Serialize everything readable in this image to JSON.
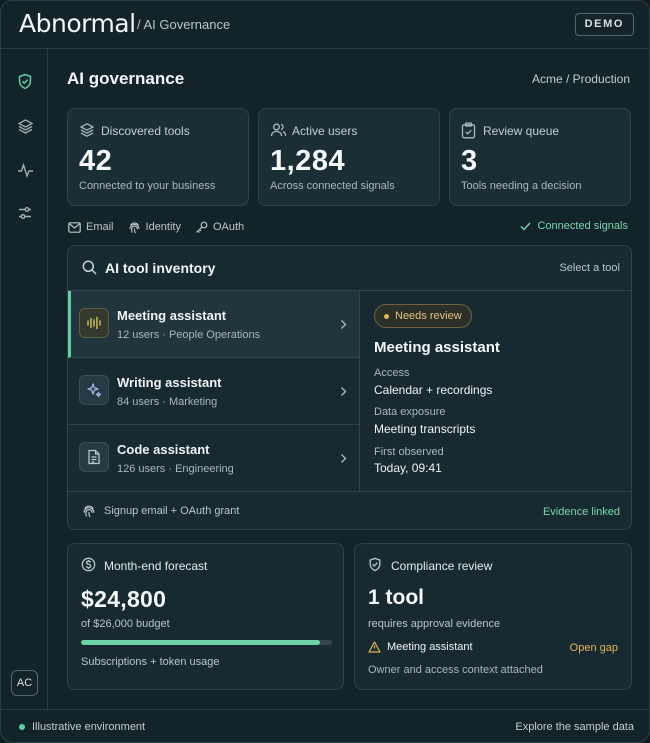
{
  "topbar": {
    "logo": "Abnormal",
    "breadcrumb": "/ AI Governance",
    "badge": "DEMO"
  },
  "sidebar": {
    "items": [
      {
        "icon": "shield-icon",
        "active": true
      },
      {
        "icon": "layers-icon",
        "active": false
      },
      {
        "icon": "activity-icon",
        "active": false
      },
      {
        "icon": "sliders-icon",
        "active": false
      }
    ],
    "avatar": "AC"
  },
  "header": {
    "title": "AI governance",
    "environment": "Acme / Production"
  },
  "stats": [
    {
      "icon": "stack-icon",
      "label": "Discovered tools",
      "value": "42",
      "sub": "Connected to your business"
    },
    {
      "icon": "users-icon",
      "label": "Active users",
      "value": "1,284",
      "sub": "Across connected signals"
    },
    {
      "icon": "clipboard-icon",
      "label": "Review queue",
      "value": "3",
      "sub": "Tools needing a decision"
    }
  ],
  "signals": {
    "items": [
      "Email",
      "Identity",
      "OAuth"
    ],
    "status": "Connected signals"
  },
  "inventory": {
    "title": "AI tool inventory",
    "select_hint": "Select a tool",
    "tools": [
      {
        "name": "Meeting assistant",
        "meta": "12 users · People Operations",
        "icon": "waveform-icon"
      },
      {
        "name": "Writing assistant",
        "meta": "84 users · Marketing",
        "icon": "sparkle-icon"
      },
      {
        "name": "Code assistant",
        "meta": "126 users · Engineering",
        "icon": "document-icon"
      }
    ],
    "detail": {
      "status": "Needs review",
      "title": "Meeting assistant",
      "access_label": "Access",
      "access_value": "Calendar + recordings",
      "exposure_label": "Data exposure",
      "exposure_value": "Meeting transcripts",
      "observed_label": "First observed",
      "observed_value": "Today, 09:41"
    },
    "footer": {
      "source": "Signup email + OAuth grant",
      "link": "Evidence linked"
    }
  },
  "forecast": {
    "title": "Month-end forecast",
    "value": "$24,800",
    "budget": "of $26,000 budget",
    "progress": 0.954,
    "note": "Subscriptions + token usage"
  },
  "compliance": {
    "title": "Compliance review",
    "value": "1 tool",
    "sub": "requires approval evidence",
    "item": "Meeting assistant",
    "gap": "Open gap",
    "note": "Owner and access context attached"
  },
  "footer": {
    "left": "Illustrative environment",
    "right": "Explore the sample data"
  },
  "colors": {
    "accent": "#5fcfa0",
    "warning": "#e4b35a",
    "background": "#13232a"
  }
}
